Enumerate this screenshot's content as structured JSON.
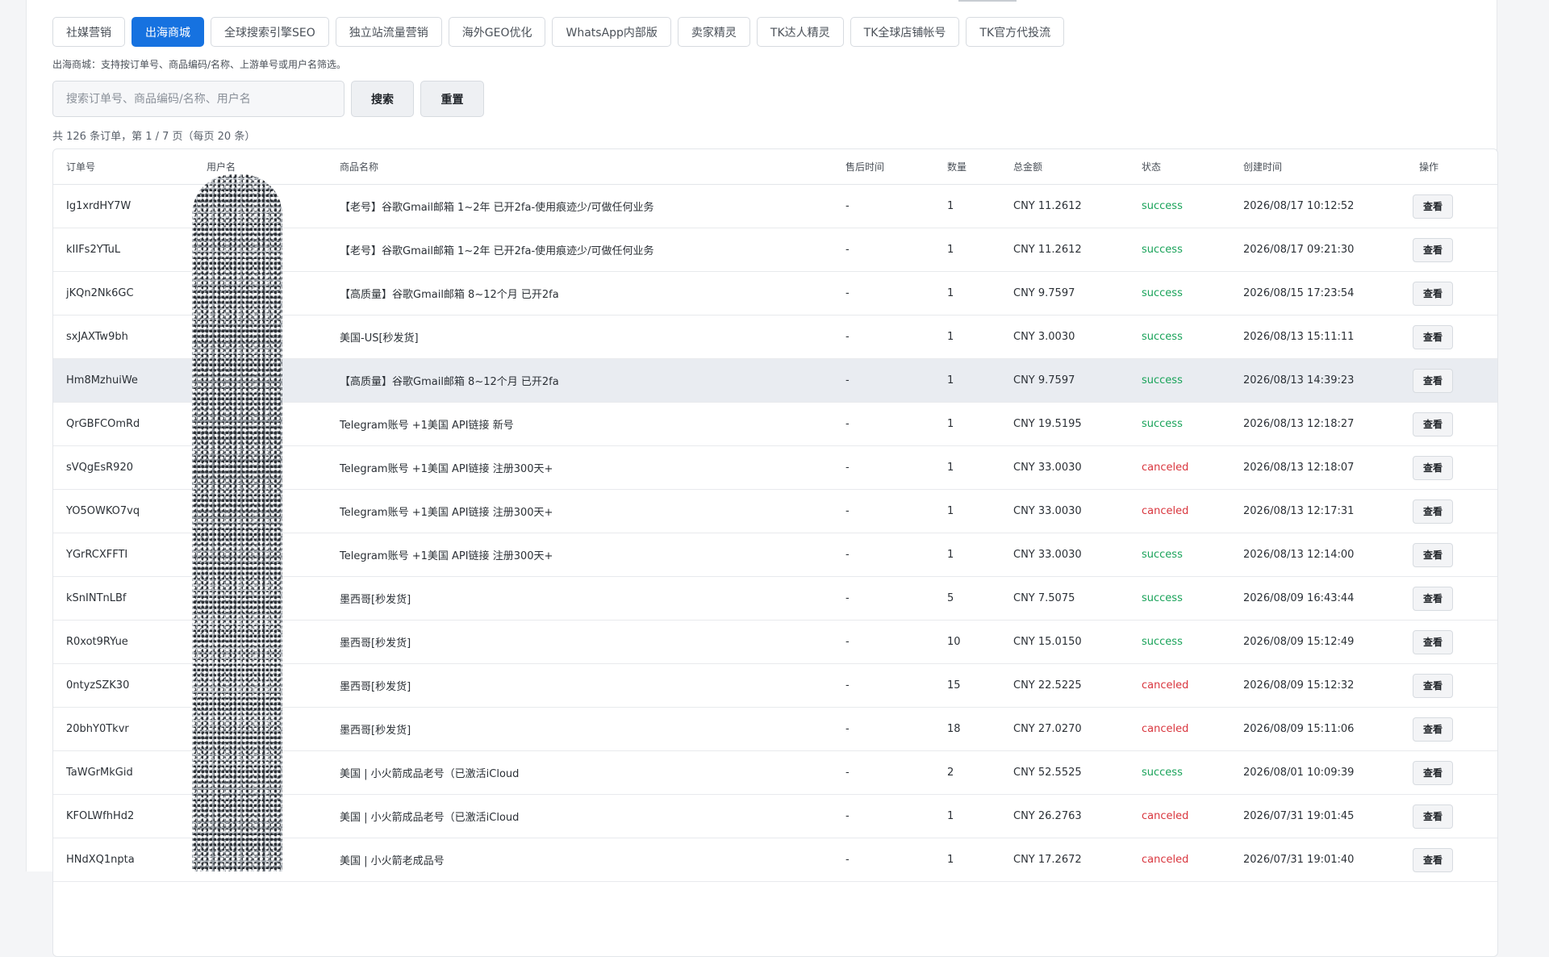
{
  "tabs": [
    {
      "label": "社媒营销",
      "active": false
    },
    {
      "label": "出海商城",
      "active": true
    },
    {
      "label": "全球搜索引擎SEO",
      "active": false
    },
    {
      "label": "独立站流量营销",
      "active": false
    },
    {
      "label": "海外GEO优化",
      "active": false
    },
    {
      "label": "WhatsApp内部版",
      "active": false
    },
    {
      "label": "卖家精灵",
      "active": false
    },
    {
      "label": "TK达人精灵",
      "active": false
    },
    {
      "label": "TK全球店铺帐号",
      "active": false
    },
    {
      "label": "TK官方代投流",
      "active": false
    }
  ],
  "hint": "出海商城：支持按订单号、商品编码/名称、上游单号或用户名筛选。",
  "search": {
    "placeholder": "搜索订单号、商品编码/名称、用户名",
    "value": "",
    "search_label": "搜索",
    "reset_label": "重置"
  },
  "summary": "共 126 条订单，第 1 / 7 页（每页 20 条）",
  "colors": {
    "accent": "#1672e0",
    "success": "#1aa35a",
    "canceled": "#d9363e"
  },
  "table": {
    "columns": [
      "订单号",
      "用户名",
      "商品名称",
      "售后时间",
      "数量",
      "总金额",
      "状态",
      "创建时间",
      "操作"
    ],
    "view_label": "查看",
    "rows": [
      {
        "order": "Ig1xrdHY7W",
        "user": "",
        "product": "【老号】谷歌Gmail邮箱 1~2年 已开2fa-使用痕迹少/可做任何业务",
        "after_sale": "-",
        "qty": "1",
        "amount": "CNY 11.2612",
        "status": "success",
        "created": "2026/08/17 10:12:52"
      },
      {
        "order": "kIIFs2YTuL",
        "user": "",
        "product": "【老号】谷歌Gmail邮箱 1~2年 已开2fa-使用痕迹少/可做任何业务",
        "after_sale": "-",
        "qty": "1",
        "amount": "CNY 11.2612",
        "status": "success",
        "created": "2026/08/17 09:21:30"
      },
      {
        "order": "jKQn2Nk6GC",
        "user": "",
        "product": "【高质量】谷歌Gmail邮箱 8~12个月 已开2fa",
        "after_sale": "-",
        "qty": "1",
        "amount": "CNY 9.7597",
        "status": "success",
        "created": "2026/08/15 17:23:54"
      },
      {
        "order": "sxJAXTw9bh",
        "user": "",
        "product": "美国-US[秒发货]",
        "after_sale": "-",
        "qty": "1",
        "amount": "CNY 3.0030",
        "status": "success",
        "created": "2026/08/13 15:11:11"
      },
      {
        "order": "Hm8MzhuiWe",
        "user": "",
        "product": "【高质量】谷歌Gmail邮箱 8~12个月 已开2fa",
        "after_sale": "-",
        "qty": "1",
        "amount": "CNY 9.7597",
        "status": "success",
        "created": "2026/08/13 14:39:23",
        "highlight": true
      },
      {
        "order": "QrGBFCOmRd",
        "user": "",
        "product": "Telegram账号 +1美国 API链接 新号",
        "after_sale": "-",
        "qty": "1",
        "amount": "CNY 19.5195",
        "status": "success",
        "created": "2026/08/13 12:18:27"
      },
      {
        "order": "sVQgEsR920",
        "user": "",
        "product": "Telegram账号 +1美国 API链接 注册300天+",
        "after_sale": "-",
        "qty": "1",
        "amount": "CNY 33.0030",
        "status": "canceled",
        "created": "2026/08/13 12:18:07"
      },
      {
        "order": "YO5OWKO7vq",
        "user": "",
        "product": "Telegram账号 +1美国 API链接 注册300天+",
        "after_sale": "-",
        "qty": "1",
        "amount": "CNY 33.0030",
        "status": "canceled",
        "created": "2026/08/13 12:17:31"
      },
      {
        "order": "YGrRCXFFTI",
        "user": "",
        "product": "Telegram账号 +1美国 API链接 注册300天+",
        "after_sale": "-",
        "qty": "1",
        "amount": "CNY 33.0030",
        "status": "success",
        "created": "2026/08/13 12:14:00"
      },
      {
        "order": "kSnINTnLBf",
        "user": "",
        "product": "墨西哥[秒发货]",
        "after_sale": "-",
        "qty": "5",
        "amount": "CNY 7.5075",
        "status": "success",
        "created": "2026/08/09 16:43:44"
      },
      {
        "order": "R0xot9RYue",
        "user": "",
        "product": "墨西哥[秒发货]",
        "after_sale": "-",
        "qty": "10",
        "amount": "CNY 15.0150",
        "status": "success",
        "created": "2026/08/09 15:12:49"
      },
      {
        "order": "0ntyzSZK30",
        "user": "",
        "product": "墨西哥[秒发货]",
        "after_sale": "-",
        "qty": "15",
        "amount": "CNY 22.5225",
        "status": "canceled",
        "created": "2026/08/09 15:12:32"
      },
      {
        "order": "20bhY0Tkvr",
        "user": "",
        "product": "墨西哥[秒发货]",
        "after_sale": "-",
        "qty": "18",
        "amount": "CNY 27.0270",
        "status": "canceled",
        "created": "2026/08/09 15:11:06"
      },
      {
        "order": "TaWGrMkGid",
        "user": "",
        "product": "美国 | 小火箭成品老号（已激活iCloud",
        "after_sale": "-",
        "qty": "2",
        "amount": "CNY 52.5525",
        "status": "success",
        "created": "2026/08/01 10:09:39"
      },
      {
        "order": "KFOLWfhHd2",
        "user": "",
        "product": "美国 | 小火箭成品老号（已激活iCloud",
        "after_sale": "-",
        "qty": "1",
        "amount": "CNY 26.2763",
        "status": "canceled",
        "created": "2026/07/31 19:01:45"
      },
      {
        "order": "HNdXQ1npta",
        "user": "",
        "product": "美国 | 小火箭老成品号",
        "after_sale": "-",
        "qty": "1",
        "amount": "CNY 17.2672",
        "status": "canceled",
        "created": "2026/07/31 19:01:40"
      }
    ]
  }
}
